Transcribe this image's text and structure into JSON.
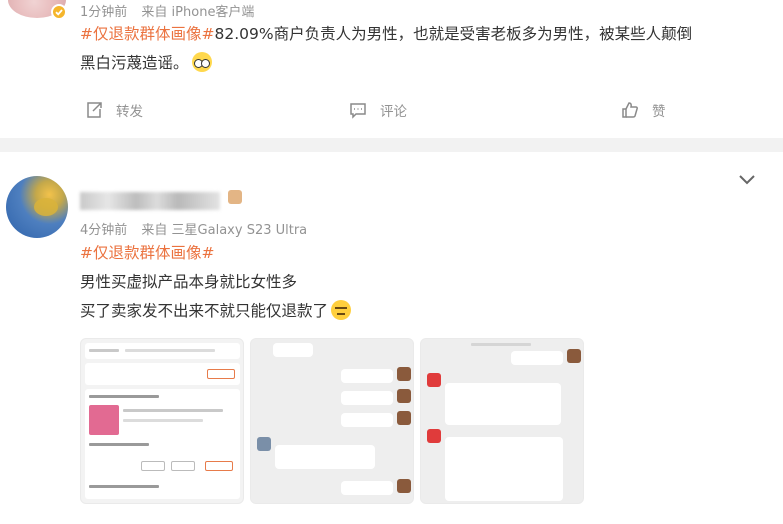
{
  "post1": {
    "time": "1分钟前",
    "source": "来自 iPhone客户端",
    "topic": "#仅退款群体画像#",
    "text_line1": "82.09%商户负责人为男性，也就是受害老板多为男性，被某些人颠倒",
    "text_line2": "黑白污蔑造谣。",
    "actions": {
      "repost": "转发",
      "comment": "评论",
      "like": "赞"
    }
  },
  "post2": {
    "time": "4分钟前",
    "source": "来自 三星Galaxy S23 Ultra",
    "topic": "#仅退款群体画像#",
    "line1": "男性买虚拟产品本身就比女性多",
    "line2": "买了卖家发不出来不就只能仅退款了"
  },
  "icons": {
    "verify": "verified-badge-icon",
    "repost": "repost-icon",
    "comment": "comment-icon",
    "like": "thumbs-up-icon",
    "more": "chevron-down-icon"
  },
  "colors": {
    "topic": "#eb7340",
    "meta": "#939393",
    "text": "#333333"
  }
}
